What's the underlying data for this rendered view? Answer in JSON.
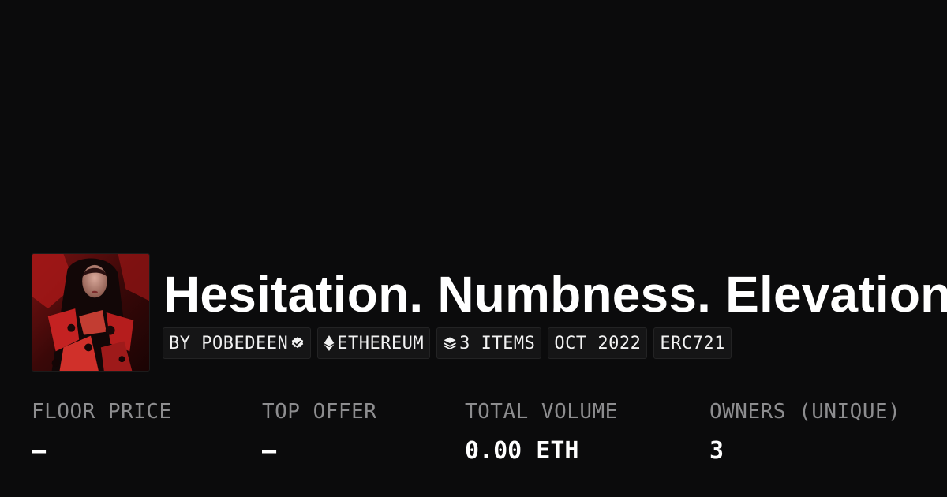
{
  "collection": {
    "title": "Hesitation. Numbness. Elevation",
    "thumbnail_icon": "collection-artwork-portrait"
  },
  "tags": {
    "creator": "BY POBEDEEN",
    "creator_icon": "verified-badge-icon",
    "chain": "ETHEREUM",
    "chain_icon": "ethereum-icon",
    "items": "3 ITEMS",
    "items_icon": "stack-icon",
    "date": "OCT 2022",
    "standard": "ERC721"
  },
  "stats": {
    "floor_price": {
      "label": "FLOOR PRICE",
      "value": "–"
    },
    "top_offer": {
      "label": "TOP OFFER",
      "value": "–"
    },
    "total_volume": {
      "label": "TOTAL VOLUME",
      "value": "0.00 ETH"
    },
    "owners": {
      "label": "OWNERS (UNIQUE)",
      "value": "3"
    }
  },
  "colors": {
    "background": "#0b0b0c",
    "tag_background": "#151516",
    "label_gray": "#8d8d8f",
    "text": "#ffffff"
  }
}
